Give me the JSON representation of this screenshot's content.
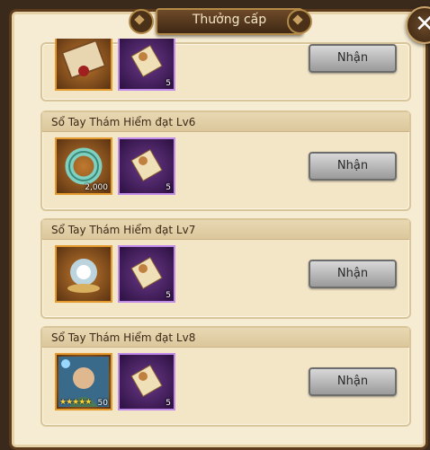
{
  "header": {
    "title": "Thưởng cấp"
  },
  "rows": [
    {
      "title": "",
      "items": [
        {
          "kind": "scroll-box-icon",
          "count": ""
        },
        {
          "kind": "scroll-icon",
          "count": "5"
        }
      ],
      "button": "Nhận"
    },
    {
      "title": "Sổ Tay Thám Hiểm đạt Lv6",
      "items": [
        {
          "kind": "jade-ring-icon",
          "count": "2,000"
        },
        {
          "kind": "scroll-icon",
          "count": "5"
        }
      ],
      "button": "Nhận"
    },
    {
      "title": "Sổ Tay Thám Hiểm đạt Lv7",
      "items": [
        {
          "kind": "blue-crystal-icon",
          "count": ""
        },
        {
          "kind": "scroll-icon",
          "count": "5"
        }
      ],
      "button": "Nhận"
    },
    {
      "title": "Sổ Tay Thám Hiểm đạt Lv8",
      "items": [
        {
          "kind": "hero-portrait-icon",
          "count": "50",
          "stars": "★★★★★"
        },
        {
          "kind": "scroll-icon",
          "count": "5"
        }
      ],
      "button": "Nhận"
    }
  ],
  "colors": {
    "button_bg": "#b0b0b0",
    "panel_bg": "#f6ecd3",
    "gold_border": "#e59a2e",
    "purple_border": "#c08ae8"
  }
}
